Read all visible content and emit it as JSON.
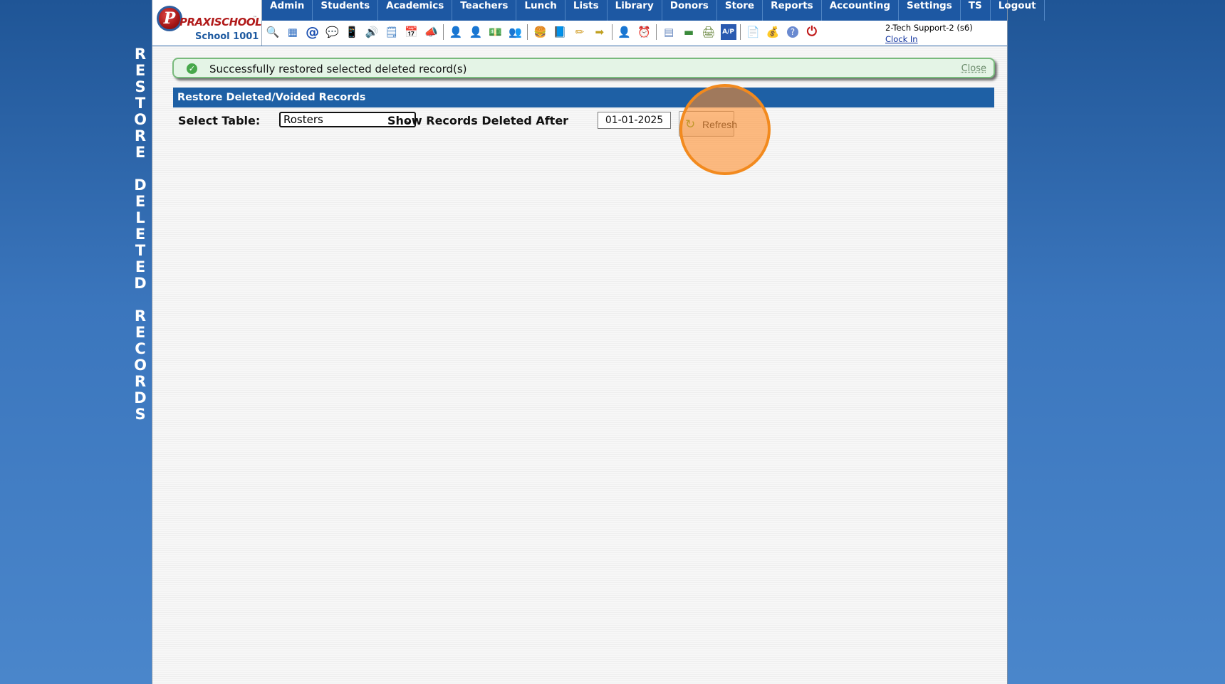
{
  "side_title": [
    "R",
    "E",
    "S",
    "T",
    "O",
    "R",
    "E",
    " ",
    "D",
    "E",
    "L",
    "E",
    "T",
    "E",
    "D",
    " ",
    "R",
    "E",
    "C",
    "O",
    "R",
    "D",
    "S"
  ],
  "logo": {
    "letter": "P",
    "brand": "PRAXISCHOOL",
    "tm": "™",
    "school": "School 1001"
  },
  "menu": [
    "Admin",
    "Students",
    "Academics",
    "Teachers",
    "Lunch",
    "Lists",
    "Library",
    "Donors",
    "Store",
    "Reports",
    "Accounting",
    "Settings",
    "TS",
    "Logout"
  ],
  "toolbar_icons": [
    {
      "name": "search-icon",
      "glyph": "🔍"
    },
    {
      "name": "grid-icon",
      "glyph": "▦"
    },
    {
      "name": "email-icon",
      "glyph": "@"
    },
    {
      "name": "chat-icon",
      "glyph": "💬"
    },
    {
      "name": "mobile-icon",
      "glyph": "📱"
    },
    {
      "name": "speaker-icon",
      "glyph": "🔊"
    },
    {
      "name": "document-icon",
      "glyph": "🗒"
    },
    {
      "name": "calendar-icon",
      "glyph": "📅"
    },
    {
      "name": "megaphone-icon",
      "glyph": "📣"
    },
    "sep",
    {
      "name": "add-student-icon",
      "glyph": "👤"
    },
    {
      "name": "student-icon",
      "glyph": "👤"
    },
    {
      "name": "money-icon",
      "glyph": "💵"
    },
    {
      "name": "family-icon",
      "glyph": "👥"
    },
    "sep",
    {
      "name": "lunch-icon",
      "glyph": "🍔"
    },
    {
      "name": "book-icon",
      "glyph": "📘"
    },
    {
      "name": "pencil-icon",
      "glyph": "✏"
    },
    {
      "name": "export-icon",
      "glyph": "➡"
    },
    "sep",
    {
      "name": "teacher-icon",
      "glyph": "👤"
    },
    {
      "name": "clock-icon",
      "glyph": "⏰"
    },
    "sep",
    {
      "name": "list-icon",
      "glyph": "▤"
    },
    {
      "name": "barcode-icon",
      "glyph": "▬"
    },
    {
      "name": "printer-icon",
      "glyph": "🖨"
    },
    {
      "name": "ap-icon",
      "glyph": "A/P"
    },
    "sep",
    {
      "name": "pdf-icon",
      "glyph": "📄"
    },
    {
      "name": "cash-icon",
      "glyph": "💰"
    },
    {
      "name": "help-icon",
      "glyph": "?"
    },
    {
      "name": "power-icon",
      "glyph": "⏻"
    }
  ],
  "user": {
    "name": "2-Tech Support-2 (s6)",
    "clock_link": "Clock In"
  },
  "notice": {
    "message": "Successfully restored selected deleted record(s)",
    "close_label": "Close",
    "color": "#47a84b"
  },
  "section": {
    "title": "Restore Deleted/Voided Records",
    "color": "#1e60a5"
  },
  "filter": {
    "table_label": "Select Table:",
    "table_value": "Rosters",
    "after_label": "Show Records Deleted After",
    "date_value": "01-01-2025",
    "refresh_label": "Refresh"
  }
}
